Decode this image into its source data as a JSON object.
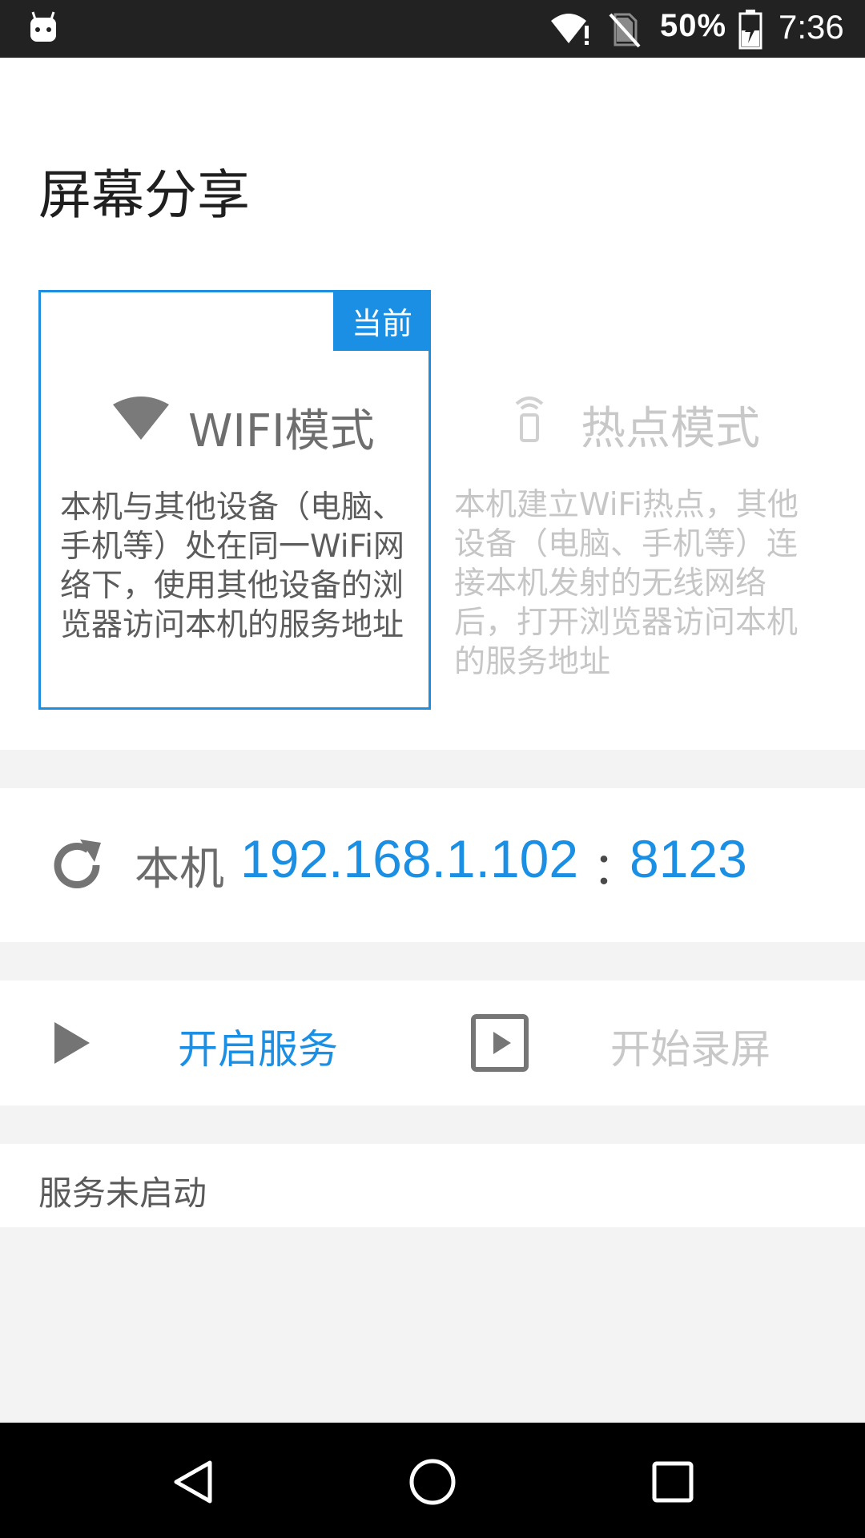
{
  "status_bar": {
    "battery_percent": "50%",
    "time": "7:36",
    "icons": [
      "android-app-icon",
      "wifi-icon",
      "no-sim-icon",
      "battery-charging-icon"
    ]
  },
  "header": {
    "title": "屏幕分享"
  },
  "modes": {
    "wifi": {
      "badge": "当前",
      "label": "WIFI模式",
      "description": "本机与其他设备（电脑、手机等）处在同一WiFi网络下，使用其他设备的浏览器访问本机的服务地址",
      "icon": "wifi-icon",
      "selected": true
    },
    "hotspot": {
      "label": "热点模式",
      "description": "本机建立WiFi热点，其他设备（电脑、手机等）连接本机发射的无线网络后，打开浏览器访问本机的服务地址",
      "icon": "hotspot-icon",
      "selected": false
    }
  },
  "address": {
    "label": "本机",
    "ip": "192.168.1.102",
    "separator": "：",
    "port": "8123",
    "icon": "refresh-icon"
  },
  "actions": {
    "start_service": "开启服务",
    "start_record": "开始录屏"
  },
  "service_status": "服务未启动",
  "colors": {
    "accent": "#1a8fe3",
    "status_bar": "#222222",
    "nav_bar": "#000000",
    "background": "#f3f3f3",
    "disabled_text": "#c8c8c8"
  }
}
